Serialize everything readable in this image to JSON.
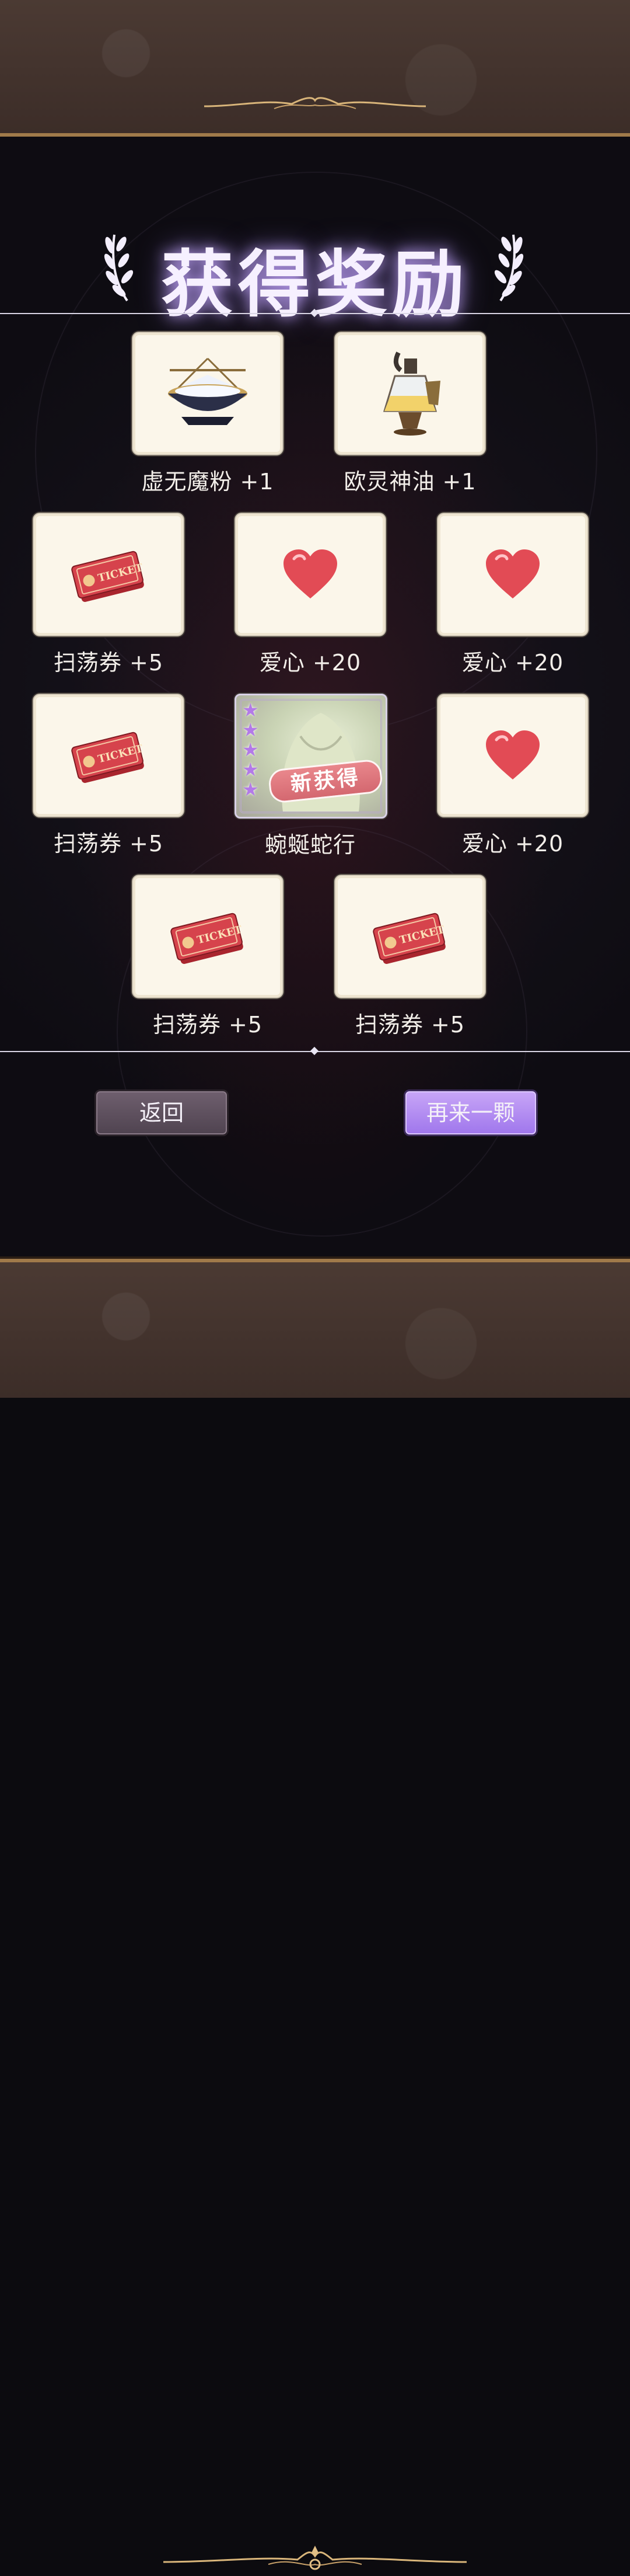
{
  "title": "获得奖励",
  "rewards": [
    {
      "label": "虚无魔粉 +1",
      "icon": "powder-bowl-icon"
    },
    {
      "label": "欧灵神油 +1",
      "icon": "oil-flask-icon"
    },
    {
      "label": "扫荡券 +5",
      "icon": "ticket-icon"
    },
    {
      "label": "爱心 +20",
      "icon": "heart-icon"
    },
    {
      "label": "爱心 +20",
      "icon": "heart-icon"
    },
    {
      "label": "扫荡券 +5",
      "icon": "ticket-icon"
    },
    {
      "label": "蜿蜒蛇行",
      "icon": "card-portrait",
      "badge": "新获得",
      "stars": 5
    },
    {
      "label": "爱心 +20",
      "icon": "heart-icon"
    },
    {
      "label": "扫荡券 +5",
      "icon": "ticket-icon"
    },
    {
      "label": "扫荡券 +5",
      "icon": "ticket-icon"
    }
  ],
  "ticket_text": "TICKET",
  "buttons": {
    "back": "返回",
    "again": "再来一颗"
  },
  "colors": {
    "accent_purple": "#a57cf0",
    "card_bg": "#fbf6ea",
    "heart_red": "#e24b55",
    "ticket_red": "#c9333c"
  }
}
